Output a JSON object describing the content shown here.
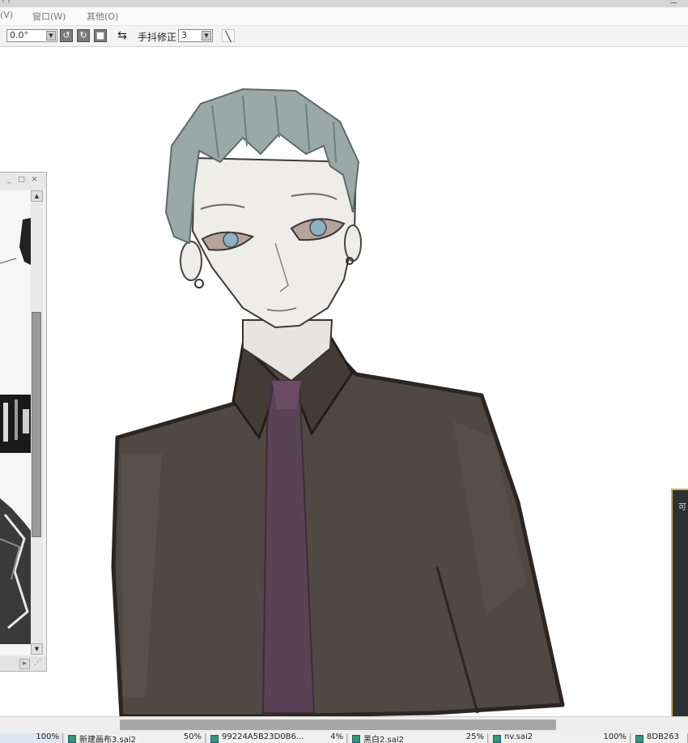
{
  "menu": {
    "items": [
      {
        "label": "(V)"
      },
      {
        "label": "窗口(W)"
      },
      {
        "label": "其他(O)"
      }
    ]
  },
  "toolbar": {
    "rotation_value": "0.0°",
    "stabilizer_label": "手抖修正",
    "stabilizer_value": "3"
  },
  "float_panel": {
    "label": "可"
  },
  "tabs": [
    {
      "label": "",
      "zoom": "100%",
      "active": true
    },
    {
      "label": "新建画布3.sai2",
      "zoom": "50%"
    },
    {
      "label": "99224A5B23D0B6...",
      "zoom": "4%"
    },
    {
      "label": "黑白2.sai2",
      "zoom": "25%"
    },
    {
      "label": "nv.sai2",
      "zoom": "100%"
    },
    {
      "label": "8DB263",
      "zoom": ""
    }
  ],
  "colors": {
    "toolbar_bg": "#f3f3f3",
    "button_gray": "#7b7b7b",
    "scroll_thumb": "#a6a6a6",
    "panel_border": "#cfb43c",
    "tab_icon": "#2f9c6d"
  },
  "icons": [
    "rotate-ccw-icon",
    "rotate-cw-icon",
    "reset-icon",
    "flip-horizontal-icon",
    "pen-pressure-icon",
    "minimize-icon",
    "maximize-icon",
    "close-icon",
    "chevron-up-icon",
    "chevron-down-icon",
    "resize-grip-icon",
    "file-icon"
  ]
}
